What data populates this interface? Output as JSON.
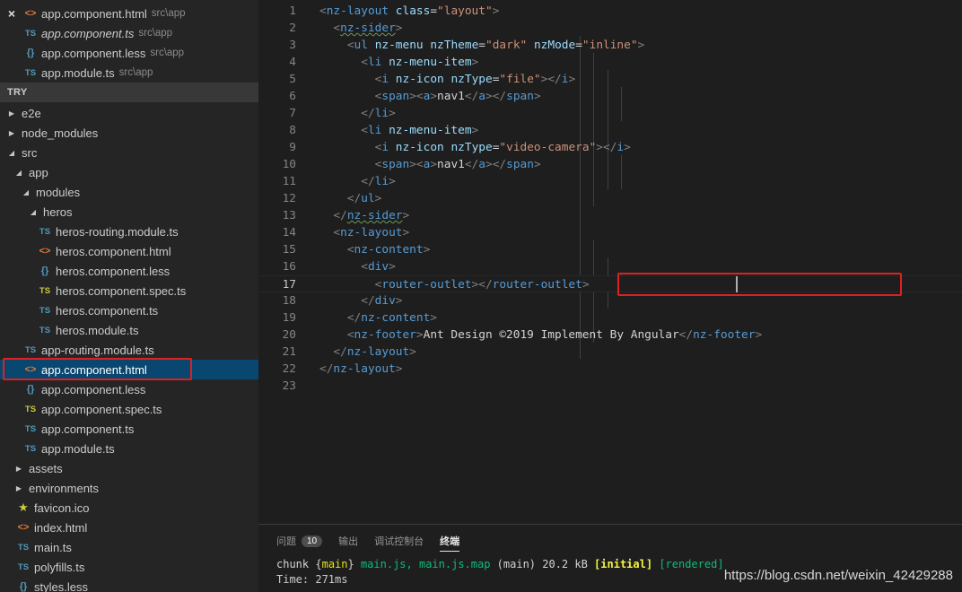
{
  "open_editors": [
    {
      "name": "app.component.html",
      "path": "src\\app",
      "icon": "html",
      "italic": false,
      "close": true
    },
    {
      "name": "app.component.ts",
      "path": "src\\app",
      "icon": "ts",
      "italic": true,
      "close": false
    },
    {
      "name": "app.component.less",
      "path": "src\\app",
      "icon": "less",
      "italic": false,
      "close": false
    },
    {
      "name": "app.module.ts",
      "path": "src\\app",
      "icon": "ts",
      "italic": false,
      "close": false
    }
  ],
  "icons": {
    "close": "×",
    "html": "<>",
    "ts": "TS",
    "less": "{}",
    "star": "★",
    "twisty_collapsed": "▶",
    "twisty_expanded": "◢"
  },
  "explorer": {
    "section_title": "TRY",
    "items": [
      {
        "label": "e2e",
        "type": "folder",
        "depth": 0,
        "expanded": false
      },
      {
        "label": "node_modules",
        "type": "folder",
        "depth": 0,
        "expanded": false
      },
      {
        "label": "src",
        "type": "folder",
        "depth": 0,
        "expanded": true
      },
      {
        "label": "app",
        "type": "folder",
        "depth": 1,
        "expanded": true
      },
      {
        "label": "modules",
        "type": "folder",
        "depth": 2,
        "expanded": true
      },
      {
        "label": "heros",
        "type": "folder",
        "depth": 3,
        "expanded": true
      },
      {
        "label": "heros-routing.module.ts",
        "type": "ts",
        "depth": 4
      },
      {
        "label": "heros.component.html",
        "type": "html",
        "depth": 4
      },
      {
        "label": "heros.component.less",
        "type": "less",
        "depth": 4
      },
      {
        "label": "heros.component.spec.ts",
        "type": "ts-spec",
        "depth": 4
      },
      {
        "label": "heros.component.ts",
        "type": "ts",
        "depth": 4
      },
      {
        "label": "heros.module.ts",
        "type": "ts",
        "depth": 4
      },
      {
        "label": "app-routing.module.ts",
        "type": "ts",
        "depth": 2
      },
      {
        "label": "app.component.html",
        "type": "html",
        "depth": 2,
        "selected": true
      },
      {
        "label": "app.component.less",
        "type": "less",
        "depth": 2
      },
      {
        "label": "app.component.spec.ts",
        "type": "ts-spec",
        "depth": 2
      },
      {
        "label": "app.component.ts",
        "type": "ts",
        "depth": 2
      },
      {
        "label": "app.module.ts",
        "type": "ts",
        "depth": 2
      },
      {
        "label": "assets",
        "type": "folder",
        "depth": 1,
        "expanded": false
      },
      {
        "label": "environments",
        "type": "folder",
        "depth": 1,
        "expanded": false
      },
      {
        "label": "favicon.ico",
        "type": "star",
        "depth": 1
      },
      {
        "label": "index.html",
        "type": "html",
        "depth": 1
      },
      {
        "label": "main.ts",
        "type": "ts",
        "depth": 1
      },
      {
        "label": "polyfills.ts",
        "type": "ts",
        "depth": 1
      },
      {
        "label": "styles.less",
        "type": "less",
        "depth": 1
      }
    ]
  },
  "editor": {
    "active_line": 17,
    "lines": [
      {
        "n": "1",
        "tokens": [
          [
            "p",
            "<"
          ],
          [
            "t",
            "nz-layout"
          ],
          [
            "x",
            " "
          ],
          [
            "a",
            "class"
          ],
          [
            "x",
            "="
          ],
          [
            "s",
            "\"layout\""
          ],
          [
            "p",
            ">"
          ]
        ]
      },
      {
        "n": "2",
        "tokens": [
          [
            "x",
            "  "
          ],
          [
            "p",
            "<"
          ],
          [
            "t",
            "nz-sider",
            "sq"
          ],
          [
            "p",
            ">"
          ]
        ]
      },
      {
        "n": "3",
        "tokens": [
          [
            "x",
            "    "
          ],
          [
            "p",
            "<"
          ],
          [
            "t",
            "ul"
          ],
          [
            "x",
            " "
          ],
          [
            "a",
            "nz-menu"
          ],
          [
            "x",
            " "
          ],
          [
            "a",
            "nzTheme"
          ],
          [
            "x",
            "="
          ],
          [
            "s",
            "\"dark\""
          ],
          [
            "x",
            " "
          ],
          [
            "a",
            "nzMode"
          ],
          [
            "x",
            "="
          ],
          [
            "s",
            "\"inline\""
          ],
          [
            "p",
            ">"
          ]
        ]
      },
      {
        "n": "4",
        "tokens": [
          [
            "x",
            "      "
          ],
          [
            "p",
            "<"
          ],
          [
            "t",
            "li"
          ],
          [
            "x",
            " "
          ],
          [
            "a",
            "nz-menu-item"
          ],
          [
            "p",
            ">"
          ]
        ]
      },
      {
        "n": "5",
        "tokens": [
          [
            "x",
            "        "
          ],
          [
            "p",
            "<"
          ],
          [
            "t",
            "i"
          ],
          [
            "x",
            " "
          ],
          [
            "a",
            "nz-icon"
          ],
          [
            "x",
            " "
          ],
          [
            "a",
            "nzType"
          ],
          [
            "x",
            "="
          ],
          [
            "s",
            "\"file\""
          ],
          [
            "p",
            "></"
          ],
          [
            "t",
            "i"
          ],
          [
            "p",
            ">"
          ]
        ]
      },
      {
        "n": "6",
        "tokens": [
          [
            "x",
            "        "
          ],
          [
            "p",
            "<"
          ],
          [
            "t",
            "span"
          ],
          [
            "p",
            "><"
          ],
          [
            "t",
            "a"
          ],
          [
            "p",
            ">"
          ],
          [
            "x",
            "nav1"
          ],
          [
            "p",
            "</"
          ],
          [
            "t",
            "a"
          ],
          [
            "p",
            "></"
          ],
          [
            "t",
            "span"
          ],
          [
            "p",
            ">"
          ]
        ]
      },
      {
        "n": "7",
        "tokens": [
          [
            "x",
            "      "
          ],
          [
            "p",
            "</"
          ],
          [
            "t",
            "li"
          ],
          [
            "p",
            ">"
          ]
        ]
      },
      {
        "n": "8",
        "tokens": [
          [
            "x",
            "      "
          ],
          [
            "p",
            "<"
          ],
          [
            "t",
            "li"
          ],
          [
            "x",
            " "
          ],
          [
            "a",
            "nz-menu-item"
          ],
          [
            "p",
            ">"
          ]
        ]
      },
      {
        "n": "9",
        "tokens": [
          [
            "x",
            "        "
          ],
          [
            "p",
            "<"
          ],
          [
            "t",
            "i"
          ],
          [
            "x",
            " "
          ],
          [
            "a",
            "nz-icon"
          ],
          [
            "x",
            " "
          ],
          [
            "a",
            "nzType"
          ],
          [
            "x",
            "="
          ],
          [
            "s",
            "\"video-camera\""
          ],
          [
            "p",
            "></"
          ],
          [
            "t",
            "i"
          ],
          [
            "p",
            ">"
          ]
        ]
      },
      {
        "n": "10",
        "tokens": [
          [
            "x",
            "        "
          ],
          [
            "p",
            "<"
          ],
          [
            "t",
            "span"
          ],
          [
            "p",
            "><"
          ],
          [
            "t",
            "a"
          ],
          [
            "p",
            ">"
          ],
          [
            "x",
            "nav1"
          ],
          [
            "p",
            "</"
          ],
          [
            "t",
            "a"
          ],
          [
            "p",
            "></"
          ],
          [
            "t",
            "span"
          ],
          [
            "p",
            ">"
          ]
        ]
      },
      {
        "n": "11",
        "tokens": [
          [
            "x",
            "      "
          ],
          [
            "p",
            "</"
          ],
          [
            "t",
            "li"
          ],
          [
            "p",
            ">"
          ]
        ]
      },
      {
        "n": "12",
        "tokens": [
          [
            "x",
            "    "
          ],
          [
            "p",
            "</"
          ],
          [
            "t",
            "ul"
          ],
          [
            "p",
            ">"
          ]
        ]
      },
      {
        "n": "13",
        "tokens": [
          [
            "x",
            "  "
          ],
          [
            "p",
            "</"
          ],
          [
            "t",
            "nz-sider",
            "sq"
          ],
          [
            "p",
            ">"
          ]
        ]
      },
      {
        "n": "14",
        "tokens": [
          [
            "x",
            "  "
          ],
          [
            "p",
            "<"
          ],
          [
            "t",
            "nz-layout"
          ],
          [
            "p",
            ">"
          ]
        ]
      },
      {
        "n": "15",
        "tokens": [
          [
            "x",
            "    "
          ],
          [
            "p",
            "<"
          ],
          [
            "t",
            "nz-content"
          ],
          [
            "p",
            ">"
          ]
        ]
      },
      {
        "n": "16",
        "tokens": [
          [
            "x",
            "      "
          ],
          [
            "p",
            "<"
          ],
          [
            "t",
            "div"
          ],
          [
            "p",
            ">"
          ]
        ]
      },
      {
        "n": "17",
        "tokens": [
          [
            "x",
            "        "
          ],
          [
            "p",
            "<"
          ],
          [
            "t",
            "router-outlet"
          ],
          [
            "p",
            "></"
          ],
          [
            "t",
            "router-outlet"
          ],
          [
            "p",
            ">"
          ]
        ]
      },
      {
        "n": "18",
        "tokens": [
          [
            "x",
            "      "
          ],
          [
            "p",
            "</"
          ],
          [
            "t",
            "div"
          ],
          [
            "p",
            ">"
          ]
        ]
      },
      {
        "n": "19",
        "tokens": [
          [
            "x",
            "    "
          ],
          [
            "p",
            "</"
          ],
          [
            "t",
            "nz-content"
          ],
          [
            "p",
            ">"
          ]
        ]
      },
      {
        "n": "20",
        "tokens": [
          [
            "x",
            "    "
          ],
          [
            "p",
            "<"
          ],
          [
            "t",
            "nz-footer"
          ],
          [
            "p",
            ">"
          ],
          [
            "x",
            "Ant Design ©2019 Implement By Angular"
          ],
          [
            "p",
            "</"
          ],
          [
            "t",
            "nz-footer"
          ],
          [
            "p",
            ">"
          ]
        ]
      },
      {
        "n": "21",
        "tokens": [
          [
            "x",
            "  "
          ],
          [
            "p",
            "</"
          ],
          [
            "t",
            "nz-layout"
          ],
          [
            "p",
            ">"
          ]
        ]
      },
      {
        "n": "22",
        "tokens": [
          [
            "p",
            "</"
          ],
          [
            "t",
            "nz-layout"
          ],
          [
            "p",
            ">"
          ]
        ]
      },
      {
        "n": "23",
        "tokens": []
      }
    ]
  },
  "panel": {
    "tabs": [
      {
        "label": "问题",
        "badge": "10",
        "active": false
      },
      {
        "label": "输出",
        "active": false
      },
      {
        "label": "调试控制台",
        "active": false
      },
      {
        "label": "终端",
        "active": true
      }
    ],
    "terminal": {
      "line1": [
        [
          "x",
          "chunk "
        ],
        [
          "x",
          "{"
        ],
        [
          "y",
          "main"
        ],
        [
          "x",
          "} "
        ],
        [
          "g",
          "main.js, main.js.map"
        ],
        [
          "x",
          " (main) 20.2 kB "
        ],
        [
          "yb",
          "[initial]"
        ],
        [
          "x",
          " "
        ],
        [
          "g",
          "[rendered]"
        ]
      ],
      "line2": "Time: 271ms"
    }
  },
  "watermark": "https://blog.csdn.net/weixin_42429288"
}
